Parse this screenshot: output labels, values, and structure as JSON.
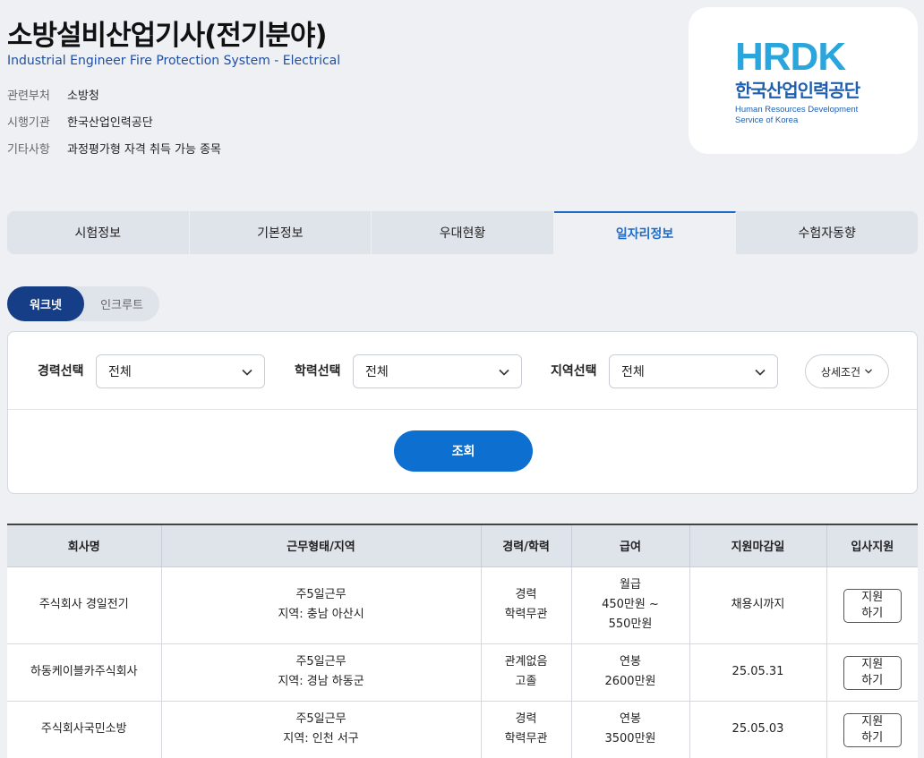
{
  "header": {
    "title": "소방설비산업기사(전기분야)",
    "subtitle": "Industrial Engineer Fire Protection System - Electrical",
    "meta": [
      {
        "key": "관련부처",
        "value": "소방청"
      },
      {
        "key": "시행기관",
        "value": "한국산업인력공단"
      },
      {
        "key": "기타사항",
        "value": "과정평가형 자격 취득 가능 종목"
      }
    ]
  },
  "logo": {
    "mark": "HRDK",
    "korean": "한국산업인력공단",
    "english_line1": "Human Resources Development",
    "english_line2": "Service of Korea",
    "color": "#1f5fae",
    "accent": "#2aa6dd"
  },
  "tabs": [
    {
      "label": "시험정보",
      "active": false
    },
    {
      "label": "기본정보",
      "active": false
    },
    {
      "label": "우대현황",
      "active": false
    },
    {
      "label": "일자리정보",
      "active": true
    },
    {
      "label": "수험자동향",
      "active": false
    }
  ],
  "source_toggle": {
    "selected": "워크넷",
    "other": "인크루트"
  },
  "filters": {
    "career": {
      "label": "경력선택",
      "value": "전체"
    },
    "education": {
      "label": "학력선택",
      "value": "전체"
    },
    "region": {
      "label": "지역선택",
      "value": "전체"
    },
    "detail_label": "상세조건",
    "search_label": "조회"
  },
  "table": {
    "headers": [
      "회사명",
      "근무형태/지역",
      "경력/학력",
      "급여",
      "지원마감일",
      "입사지원"
    ],
    "rows": [
      {
        "company": "주식회사 경일전기",
        "work": "주5일근무\n지역: 충남 아산시",
        "career": "경력\n학력무관",
        "pay": "월급\n450만원 ~\n550만원",
        "deadline": "채용시까지",
        "apply": "지원\n하기"
      },
      {
        "company": "하동케이블카주식회사",
        "work": "주5일근무\n지역: 경남 하동군",
        "career": "관계없음\n고졸",
        "pay": "연봉\n2600만원",
        "deadline": "25.05.31",
        "apply": "지원\n하기"
      },
      {
        "company": "주식회사국민소방",
        "work": "주5일근무\n지역: 인천 서구",
        "career": "경력\n학력무관",
        "pay": "연봉\n3500만원",
        "deadline": "25.05.03",
        "apply": "지원\n하기"
      }
    ]
  },
  "colors": {
    "primary": "#0d6fd0",
    "navy": "#163e86",
    "tab_active": "#1f6bc6"
  }
}
